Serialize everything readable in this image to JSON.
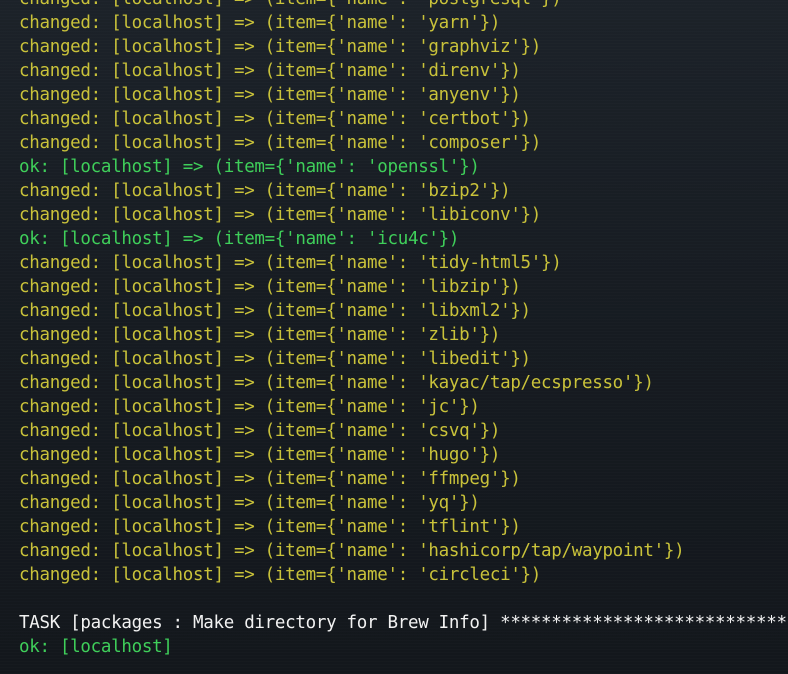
{
  "window": {
    "app": "Terminal"
  },
  "colors": {
    "background": "#171c22",
    "changed": "#c9c23a",
    "ok": "#3fcf5a",
    "task": "#f2f2f2"
  },
  "lines": [
    {
      "status": "changed",
      "text": "changed: [localhost] => (item={'name': 'postgresql'})"
    },
    {
      "status": "changed",
      "text": "changed: [localhost] => (item={'name': 'yarn'})"
    },
    {
      "status": "changed",
      "text": "changed: [localhost] => (item={'name': 'graphviz'})"
    },
    {
      "status": "changed",
      "text": "changed: [localhost] => (item={'name': 'direnv'})"
    },
    {
      "status": "changed",
      "text": "changed: [localhost] => (item={'name': 'anyenv'})"
    },
    {
      "status": "changed",
      "text": "changed: [localhost] => (item={'name': 'certbot'})"
    },
    {
      "status": "changed",
      "text": "changed: [localhost] => (item={'name': 'composer'})"
    },
    {
      "status": "ok",
      "text": "ok: [localhost] => (item={'name': 'openssl'})"
    },
    {
      "status": "changed",
      "text": "changed: [localhost] => (item={'name': 'bzip2'})"
    },
    {
      "status": "changed",
      "text": "changed: [localhost] => (item={'name': 'libiconv'})"
    },
    {
      "status": "ok",
      "text": "ok: [localhost] => (item={'name': 'icu4c'})"
    },
    {
      "status": "changed",
      "text": "changed: [localhost] => (item={'name': 'tidy-html5'})"
    },
    {
      "status": "changed",
      "text": "changed: [localhost] => (item={'name': 'libzip'})"
    },
    {
      "status": "changed",
      "text": "changed: [localhost] => (item={'name': 'libxml2'})"
    },
    {
      "status": "changed",
      "text": "changed: [localhost] => (item={'name': 'zlib'})"
    },
    {
      "status": "changed",
      "text": "changed: [localhost] => (item={'name': 'libedit'})"
    },
    {
      "status": "changed",
      "text": "changed: [localhost] => (item={'name': 'kayac/tap/ecspresso'})"
    },
    {
      "status": "changed",
      "text": "changed: [localhost] => (item={'name': 'jc'})"
    },
    {
      "status": "changed",
      "text": "changed: [localhost] => (item={'name': 'csvq'})"
    },
    {
      "status": "changed",
      "text": "changed: [localhost] => (item={'name': 'hugo'})"
    },
    {
      "status": "changed",
      "text": "changed: [localhost] => (item={'name': 'ffmpeg'})"
    },
    {
      "status": "changed",
      "text": "changed: [localhost] => (item={'name': 'yq'})"
    },
    {
      "status": "changed",
      "text": "changed: [localhost] => (item={'name': 'tflint'})"
    },
    {
      "status": "changed",
      "text": "changed: [localhost] => (item={'name': 'hashicorp/tap/waypoint'})"
    },
    {
      "status": "changed",
      "text": "changed: [localhost] => (item={'name': 'circleci'})"
    },
    {
      "status": "blank",
      "text": ""
    },
    {
      "status": "task",
      "text": "TASK [packages : Make directory for Brew Info] ********************************"
    },
    {
      "status": "ok",
      "text": "ok: [localhost]"
    }
  ]
}
